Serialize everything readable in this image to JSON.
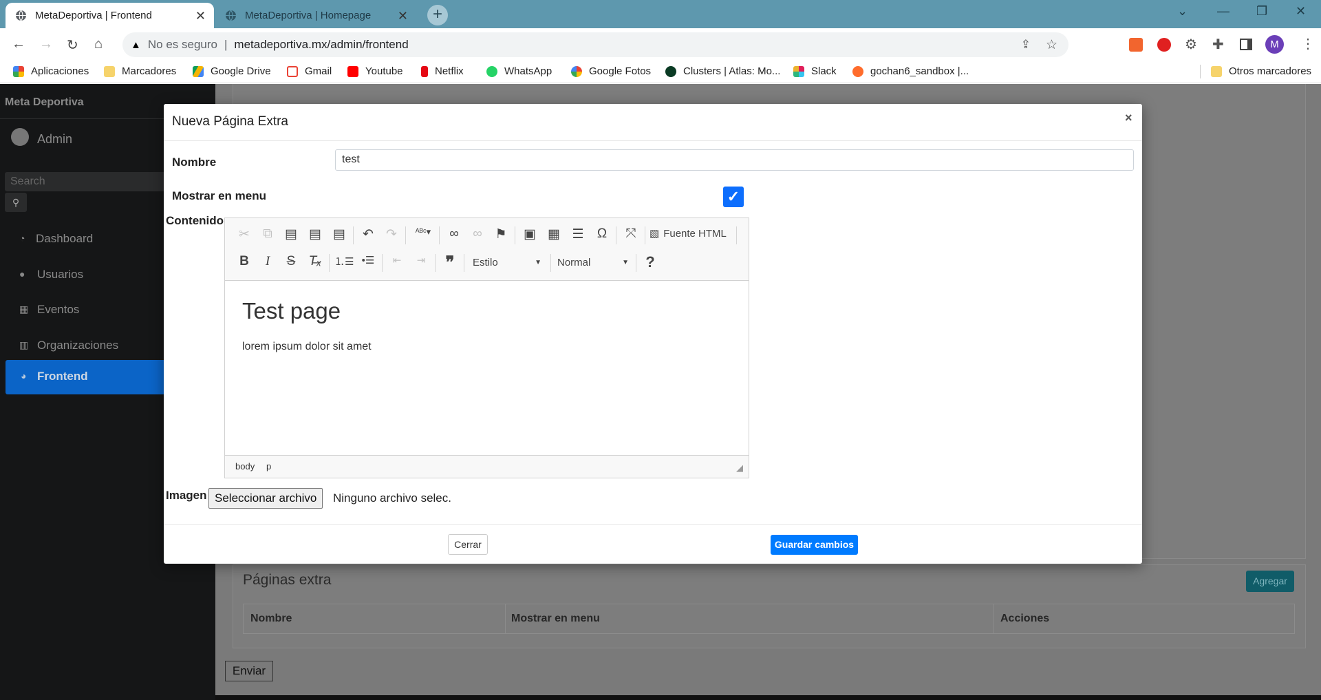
{
  "browser": {
    "tabs": [
      {
        "title": "MetaDeportiva | Frontend",
        "active": true
      },
      {
        "title": "MetaDeportiva | Homepage",
        "active": false
      }
    ],
    "security_label": "No es seguro",
    "url": "metadeportiva.mx/admin/frontend",
    "profile_initial": "M",
    "bookmarks": [
      "Aplicaciones",
      "Marcadores",
      "Google Drive",
      "Gmail",
      "Youtube",
      "Netflix",
      "WhatsApp",
      "Google Fotos",
      "Clusters | Atlas: Mo...",
      "Slack",
      "gochan6_sandbox |..."
    ],
    "other_bookmarks": "Otros marcadores"
  },
  "sidebar": {
    "brand": "Meta Deportiva",
    "user": "Admin",
    "search_placeholder": "Search",
    "items": [
      {
        "label": "Dashboard",
        "active": false
      },
      {
        "label": "Usuarios",
        "active": false
      },
      {
        "label": "Eventos",
        "active": false
      },
      {
        "label": "Organizaciones",
        "active": false
      },
      {
        "label": "Frontend",
        "active": true
      }
    ]
  },
  "background": {
    "section_title": "Páginas extra",
    "add_button": "Agregar",
    "columns": [
      "Nombre",
      "Mostrar en menu",
      "Acciones"
    ],
    "submit_button": "Enviar"
  },
  "modal": {
    "title": "Nueva Página Extra",
    "close_glyph": "×",
    "name_label": "Nombre",
    "name_value": "test",
    "menu_label": "Mostrar en menu",
    "menu_checked": true,
    "content_label": "Contenido",
    "editor": {
      "source_button": "Fuente HTML",
      "style_combo": "Estilo",
      "format_combo": "Normal",
      "help_glyph": "?",
      "heading": "Test page",
      "paragraph": "lorem ipsum dolor sit amet",
      "path": [
        "body",
        "p"
      ]
    },
    "image_label": "Imagen",
    "file_button": "Seleccionar archivo",
    "file_status": "Ninguno archivo selec.",
    "close_button": "Cerrar",
    "save_button": "Guardar cambios"
  },
  "colors": {
    "primary": "#007bff",
    "sidebar_active": "#0b64c7",
    "teal": "#17a2b8"
  }
}
